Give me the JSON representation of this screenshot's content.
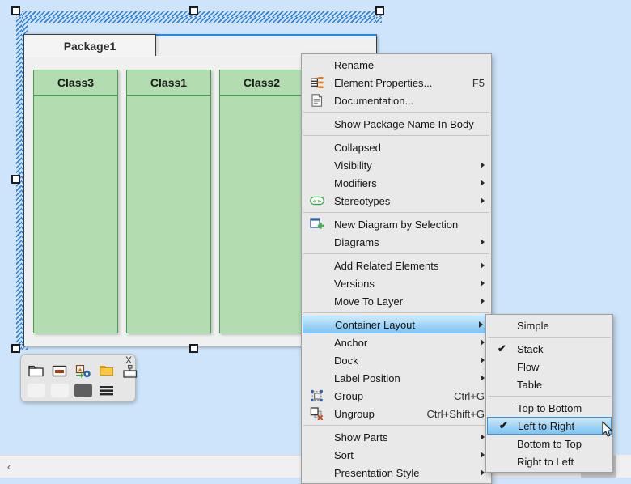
{
  "canvas": {
    "background_color": "#cde4fb",
    "package": {
      "name": "Package1",
      "classes": [
        {
          "name": "Class3"
        },
        {
          "name": "Class1"
        },
        {
          "name": "Class2"
        }
      ],
      "fill_color": "#f0f0f0",
      "class_fill_color": "#b3ddb0",
      "class_border_color": "#4a9c55",
      "selection_color": "#2f7fd8"
    }
  },
  "mini_toolbar": {
    "close_label": "X",
    "buttons": [
      {
        "icon": "folder-icon"
      },
      {
        "icon": "rectangle-bar-icon"
      },
      {
        "icon": "image-swap-icon"
      },
      {
        "icon": "yellow-folder-icon"
      },
      {
        "icon": "screen-monitor-icon"
      },
      {
        "icon": "light-swatch-icon"
      },
      {
        "icon": "pale-swatch-icon"
      },
      {
        "icon": "dark-swatch-icon"
      },
      {
        "icon": "lines-icon"
      }
    ]
  },
  "scrollbar": {
    "left_arrow": "‹"
  },
  "context_menu": {
    "items": [
      {
        "label": "Rename",
        "icon": null,
        "accel": "",
        "arrow": false,
        "highlighted": false
      },
      {
        "label": "Element Properties...",
        "icon": "element-properties-icon",
        "accel": "F5",
        "arrow": false,
        "highlighted": false
      },
      {
        "label": "Documentation...",
        "icon": "documentation-icon",
        "accel": "",
        "arrow": false,
        "highlighted": false
      },
      {
        "separator": true
      },
      {
        "label": "Show Package Name In Body",
        "icon": null,
        "accel": "",
        "arrow": false,
        "highlighted": false
      },
      {
        "separator": true
      },
      {
        "label": "Collapsed",
        "icon": null,
        "accel": "",
        "arrow": false,
        "highlighted": false
      },
      {
        "label": "Visibility",
        "icon": null,
        "accel": "",
        "arrow": true,
        "highlighted": false
      },
      {
        "label": "Modifiers",
        "icon": null,
        "accel": "",
        "arrow": true,
        "highlighted": false
      },
      {
        "label": "Stereotypes",
        "icon": "stereotypes-icon",
        "accel": "",
        "arrow": true,
        "highlighted": false
      },
      {
        "separator": true
      },
      {
        "label": "New Diagram by Selection",
        "icon": "new-diagram-icon",
        "accel": "",
        "arrow": false,
        "highlighted": false
      },
      {
        "label": "Diagrams",
        "icon": null,
        "accel": "",
        "arrow": true,
        "highlighted": false
      },
      {
        "separator": true
      },
      {
        "label": "Add Related Elements",
        "icon": null,
        "accel": "",
        "arrow": true,
        "highlighted": false
      },
      {
        "label": "Versions",
        "icon": null,
        "accel": "",
        "arrow": true,
        "highlighted": false
      },
      {
        "label": "Move To Layer",
        "icon": null,
        "accel": "",
        "arrow": true,
        "highlighted": false
      },
      {
        "separator": true
      },
      {
        "label": "Container Layout",
        "icon": null,
        "accel": "",
        "arrow": true,
        "highlighted": true
      },
      {
        "label": "Anchor",
        "icon": null,
        "accel": "",
        "arrow": true,
        "highlighted": false
      },
      {
        "label": "Dock",
        "icon": null,
        "accel": "",
        "arrow": true,
        "highlighted": false
      },
      {
        "label": "Label Position",
        "icon": null,
        "accel": "",
        "arrow": true,
        "highlighted": false
      },
      {
        "label": "Group",
        "icon": "group-icon",
        "accel": "Ctrl+G",
        "arrow": false,
        "highlighted": false
      },
      {
        "label": "Ungroup",
        "icon": "ungroup-icon",
        "accel": "Ctrl+Shift+G",
        "arrow": false,
        "highlighted": false
      },
      {
        "separator": true
      },
      {
        "label": "Show Parts",
        "icon": null,
        "accel": "",
        "arrow": true,
        "highlighted": false
      },
      {
        "label": "Sort",
        "icon": null,
        "accel": "",
        "arrow": true,
        "highlighted": false
      },
      {
        "label": "Presentation Style",
        "icon": null,
        "accel": "",
        "arrow": true,
        "highlighted": false
      }
    ]
  },
  "submenu": {
    "title": "Container Layout",
    "items": [
      {
        "label": "Simple",
        "checked": false,
        "highlighted": false
      },
      {
        "separator": true
      },
      {
        "label": "Stack",
        "checked": true,
        "highlighted": false
      },
      {
        "label": "Flow",
        "checked": false,
        "highlighted": false
      },
      {
        "label": "Table",
        "checked": false,
        "highlighted": false
      },
      {
        "separator": true
      },
      {
        "label": "Top to Bottom",
        "checked": false,
        "highlighted": false
      },
      {
        "label": "Left to Right",
        "checked": true,
        "highlighted": true
      },
      {
        "label": "Bottom to Top",
        "checked": false,
        "highlighted": false
      },
      {
        "label": "Right to Left",
        "checked": false,
        "highlighted": false
      }
    ]
  }
}
